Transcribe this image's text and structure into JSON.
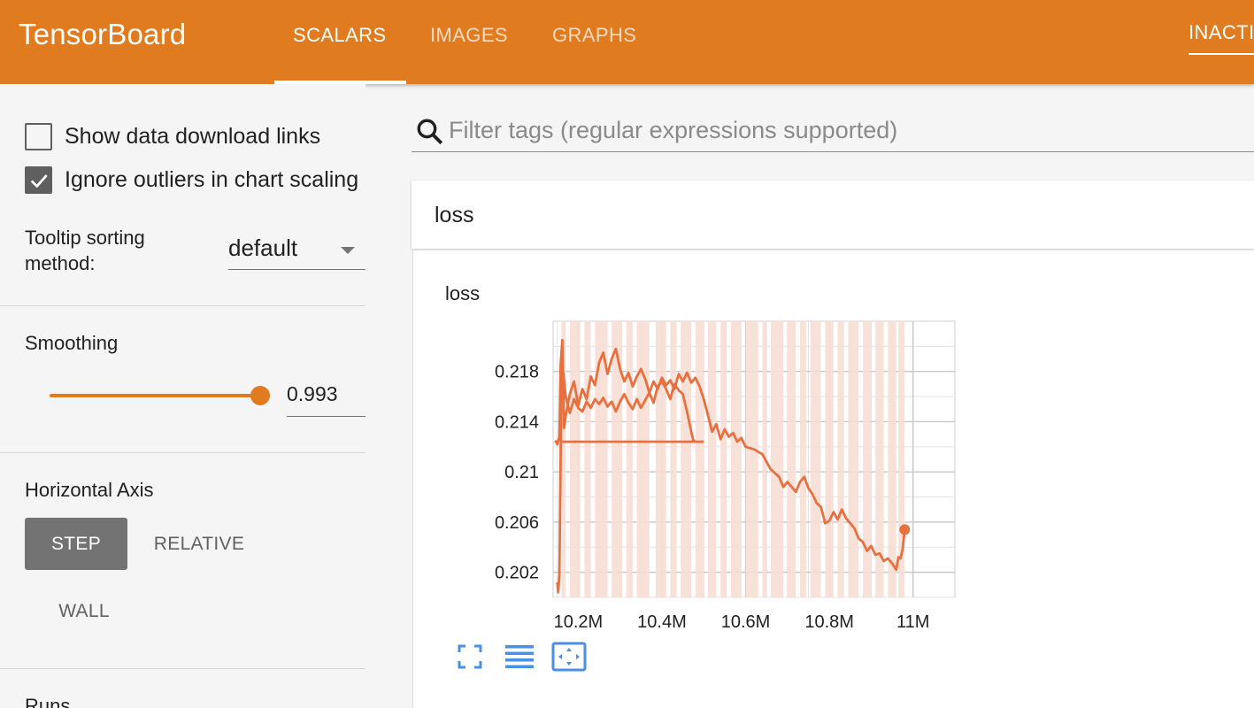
{
  "header": {
    "brand": "TensorBoard",
    "tabs": [
      {
        "label": "SCALARS",
        "active": true
      },
      {
        "label": "IMAGES",
        "active": false
      },
      {
        "label": "GRAPHS",
        "active": false
      }
    ],
    "status": "INACTIVE",
    "color": "#e07b1f"
  },
  "sidebar": {
    "show_download_links": {
      "label": "Show data download links",
      "checked": false
    },
    "ignore_outliers": {
      "label": "Ignore outliers in chart scaling",
      "checked": true
    },
    "tooltip_sorting": {
      "label": "Tooltip sorting method:",
      "value": "default"
    },
    "smoothing": {
      "title": "Smoothing",
      "value": "0.993",
      "level": 1.0
    },
    "horizontal_axis": {
      "title": "Horizontal Axis",
      "options": [
        {
          "label": "STEP",
          "active": true
        },
        {
          "label": "RELATIVE",
          "active": false
        },
        {
          "label": "WALL",
          "active": false
        }
      ]
    },
    "runs_title": "Runs"
  },
  "main": {
    "search": {
      "placeholder": "Filter tags (regular expressions supported)"
    },
    "category": {
      "title": "loss"
    },
    "card": {
      "title": "loss"
    },
    "chart_icons": [
      "fullscreen-icon",
      "toggle-log-scale-icon",
      "fit-domain-icon"
    ]
  },
  "chart_data": {
    "type": "line",
    "title": "loss",
    "xlabel": "",
    "ylabel": "",
    "xlim": [
      10.14,
      11.1
    ],
    "ylim": [
      0.2,
      0.222
    ],
    "x_ticks": [
      10.2,
      10.4,
      10.6,
      10.8,
      11.0
    ],
    "x_tick_labels": [
      "10.2M",
      "10.4M",
      "10.6M",
      "10.8M",
      "11M"
    ],
    "y_ticks": [
      0.202,
      0.206,
      0.21,
      0.214,
      0.218
    ],
    "y_tick_labels": [
      "0.202",
      "0.206",
      "0.21",
      "0.214",
      "0.218"
    ],
    "grid": true,
    "smoothed_color": "#e8703f",
    "raw_color": "#f7ded4",
    "series": [
      {
        "role": "smoothed",
        "points": [
          [
            10.145,
            0.2125
          ],
          [
            10.15,
            0.2122
          ],
          [
            10.155,
            0.2128
          ],
          [
            10.158,
            0.2185
          ],
          [
            10.162,
            0.2205
          ],
          [
            10.166,
            0.2135
          ],
          [
            10.172,
            0.2148
          ],
          [
            10.18,
            0.2162
          ],
          [
            10.19,
            0.2172
          ],
          [
            10.2,
            0.2153
          ],
          [
            10.21,
            0.2166
          ],
          [
            10.22,
            0.2158
          ],
          [
            10.23,
            0.2176
          ],
          [
            10.24,
            0.2169
          ],
          [
            10.25,
            0.2187
          ],
          [
            10.26,
            0.2195
          ],
          [
            10.27,
            0.2178
          ],
          [
            10.28,
            0.219
          ],
          [
            10.29,
            0.2198
          ],
          [
            10.3,
            0.2182
          ],
          [
            10.31,
            0.2172
          ],
          [
            10.32,
            0.2179
          ],
          [
            10.33,
            0.2168
          ],
          [
            10.34,
            0.2176
          ],
          [
            10.35,
            0.2182
          ],
          [
            10.36,
            0.2174
          ],
          [
            10.37,
            0.2163
          ],
          [
            10.38,
            0.2172
          ],
          [
            10.39,
            0.2166
          ],
          [
            10.4,
            0.2175
          ],
          [
            10.41,
            0.2169
          ],
          [
            10.42,
            0.2173
          ],
          [
            10.43,
            0.2166
          ],
          [
            10.44,
            0.2178
          ],
          [
            10.45,
            0.2172
          ],
          [
            10.46,
            0.2179
          ],
          [
            10.47,
            0.2171
          ],
          [
            10.48,
            0.2175
          ],
          [
            10.49,
            0.2168
          ],
          [
            10.5,
            0.2158
          ],
          [
            10.51,
            0.2145
          ],
          [
            10.52,
            0.2132
          ],
          [
            10.53,
            0.2138
          ],
          [
            10.54,
            0.2126
          ],
          [
            10.55,
            0.2134
          ],
          [
            10.56,
            0.2128
          ],
          [
            10.57,
            0.2131
          ],
          [
            10.58,
            0.2124
          ],
          [
            10.59,
            0.2127
          ],
          [
            10.6,
            0.212
          ],
          [
            10.62,
            0.2118
          ],
          [
            10.64,
            0.2114
          ],
          [
            10.66,
            0.2102
          ],
          [
            10.68,
            0.2096
          ],
          [
            10.69,
            0.2088
          ],
          [
            10.7,
            0.2092
          ],
          [
            10.72,
            0.2084
          ],
          [
            10.73,
            0.2092
          ],
          [
            10.74,
            0.2096
          ],
          [
            10.75,
            0.2087
          ],
          [
            10.76,
            0.2082
          ],
          [
            10.77,
            0.2075
          ],
          [
            10.78,
            0.2072
          ],
          [
            10.79,
            0.2059
          ],
          [
            10.8,
            0.2061
          ],
          [
            10.81,
            0.2068
          ],
          [
            10.82,
            0.2062
          ],
          [
            10.83,
            0.207
          ],
          [
            10.84,
            0.2063
          ],
          [
            10.85,
            0.2059
          ],
          [
            10.86,
            0.2055
          ],
          [
            10.87,
            0.2047
          ],
          [
            10.88,
            0.2044
          ],
          [
            10.89,
            0.2037
          ],
          [
            10.9,
            0.2041
          ],
          [
            10.91,
            0.2034
          ],
          [
            10.92,
            0.2035
          ],
          [
            10.93,
            0.2029
          ],
          [
            10.94,
            0.2031
          ],
          [
            10.95,
            0.2027
          ],
          [
            10.96,
            0.2022
          ],
          [
            10.965,
            0.2032
          ],
          [
            10.97,
            0.2031
          ],
          [
            10.975,
            0.2038
          ],
          [
            10.98,
            0.2054
          ]
        ]
      },
      {
        "role": "smoothed-early",
        "points": [
          [
            10.15,
            0.2012
          ],
          [
            10.152,
            0.2004
          ],
          [
            10.155,
            0.2018
          ],
          [
            10.158,
            0.2112
          ],
          [
            10.16,
            0.2193
          ],
          [
            10.17,
            0.216
          ],
          [
            10.18,
            0.2147
          ],
          [
            10.19,
            0.2158
          ],
          [
            10.2,
            0.2151
          ],
          [
            10.21,
            0.2148
          ],
          [
            10.22,
            0.2156
          ],
          [
            10.23,
            0.2151
          ],
          [
            10.24,
            0.2158
          ],
          [
            10.25,
            0.2154
          ],
          [
            10.26,
            0.2159
          ],
          [
            10.27,
            0.2152
          ],
          [
            10.28,
            0.2156
          ],
          [
            10.29,
            0.2148
          ],
          [
            10.3,
            0.2156
          ],
          [
            10.31,
            0.2162
          ],
          [
            10.32,
            0.2155
          ],
          [
            10.33,
            0.215
          ],
          [
            10.34,
            0.2158
          ],
          [
            10.35,
            0.2151
          ],
          [
            10.36,
            0.2157
          ],
          [
            10.37,
            0.2163
          ],
          [
            10.38,
            0.2155
          ],
          [
            10.39,
            0.2168
          ],
          [
            10.4,
            0.2172
          ],
          [
            10.41,
            0.2166
          ],
          [
            10.42,
            0.2158
          ],
          [
            10.43,
            0.217
          ],
          [
            10.44,
            0.2165
          ],
          [
            10.45,
            0.2162
          ],
          [
            10.46,
            0.2148
          ],
          [
            10.47,
            0.2132
          ],
          [
            10.475,
            0.2125
          ],
          [
            10.48,
            0.2124
          ]
        ]
      },
      {
        "role": "smoothed-flat",
        "points": [
          [
            10.16,
            0.2124
          ],
          [
            10.4,
            0.2124
          ],
          [
            10.5,
            0.2124
          ]
        ]
      }
    ],
    "raw_band_ranges": [
      [
        10.16,
        10.17
      ],
      [
        10.18,
        10.205
      ],
      [
        10.215,
        10.23
      ],
      [
        10.24,
        10.27
      ],
      [
        10.28,
        10.305
      ],
      [
        10.315,
        10.33
      ],
      [
        10.34,
        10.37
      ],
      [
        10.385,
        10.41
      ],
      [
        10.42,
        10.435
      ],
      [
        10.445,
        10.47
      ],
      [
        10.48,
        10.5
      ],
      [
        10.51,
        10.53
      ],
      [
        10.54,
        10.555
      ],
      [
        10.565,
        10.59
      ],
      [
        10.6,
        10.63
      ],
      [
        10.64,
        10.65
      ],
      [
        10.66,
        10.69
      ],
      [
        10.7,
        10.72
      ],
      [
        10.73,
        10.745
      ],
      [
        10.755,
        10.78
      ],
      [
        10.79,
        10.81
      ],
      [
        10.82,
        10.835
      ],
      [
        10.845,
        10.87
      ],
      [
        10.88,
        10.9
      ],
      [
        10.91,
        10.93
      ],
      [
        10.94,
        10.96
      ],
      [
        10.965,
        10.98
      ]
    ]
  }
}
